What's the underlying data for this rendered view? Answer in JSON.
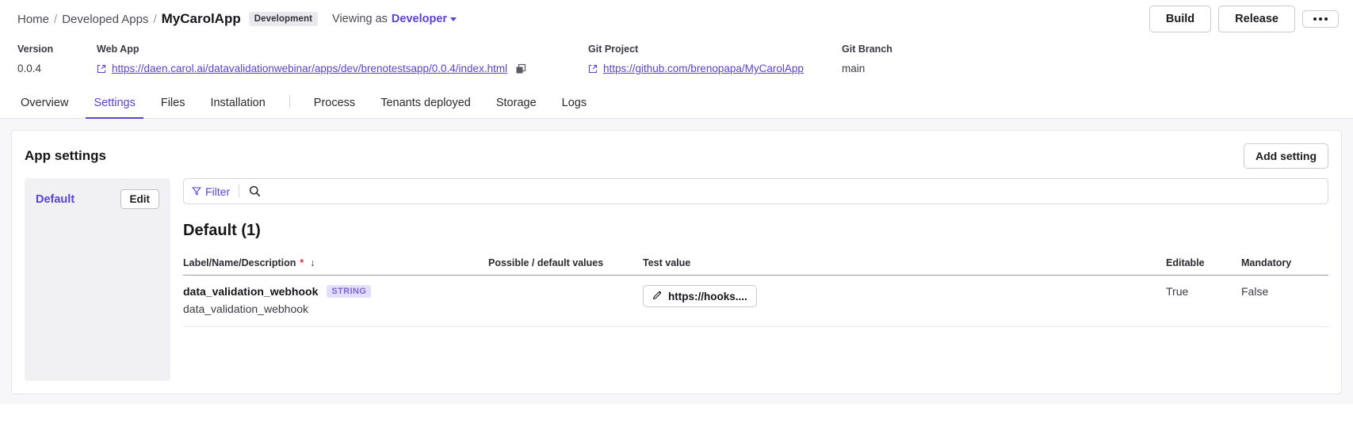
{
  "breadcrumb": {
    "home": "Home",
    "section": "Developed Apps",
    "current": "MyCarolApp",
    "env_badge": "Development",
    "viewing_as_label": "Viewing as",
    "viewer_role": "Developer"
  },
  "topbar": {
    "build_label": "Build",
    "release_label": "Release",
    "more_label": "more-options"
  },
  "meta": {
    "version_label": "Version",
    "version_value": "0.0.4",
    "webapp_label": "Web App",
    "webapp_url": "https://daen.carol.ai/datavalidationwebinar/apps/dev/brenotestsapp/0.0.4/index.html",
    "gitproject_label": "Git Project",
    "gitproject_url": "https://github.com/brenopapa/MyCarolApp",
    "gitbranch_label": "Git Branch",
    "gitbranch_value": "main"
  },
  "tabs": [
    {
      "label": "Overview",
      "active": false
    },
    {
      "label": "Settings",
      "active": true
    },
    {
      "label": "Files",
      "active": false
    },
    {
      "label": "Installation",
      "active": false
    },
    {
      "label": "Process",
      "active": false
    },
    {
      "label": "Tenants deployed",
      "active": false
    },
    {
      "label": "Storage",
      "active": false
    },
    {
      "label": "Logs",
      "active": false
    }
  ],
  "card": {
    "title": "App settings",
    "add_setting_label": "Add setting"
  },
  "groups": {
    "name": "Default",
    "edit_label": "Edit"
  },
  "toolbar": {
    "filter_label": "Filter",
    "search_placeholder": ""
  },
  "table": {
    "section_title": "Default (1)",
    "columns": {
      "label": "Label/Name/Description",
      "required_marker": "*",
      "sort_indicator": "↓",
      "possible": "Possible / default values",
      "test": "Test value",
      "editable": "Editable",
      "mandatory": "Mandatory"
    },
    "rows": [
      {
        "name": "data_validation_webhook",
        "type": "STRING",
        "description": "data_validation_webhook",
        "possible": "",
        "test_value": "https://hooks....",
        "editable": "True",
        "mandatory": "False"
      }
    ]
  },
  "colors": {
    "accent": "#5b42d6",
    "badge_bg": "#e4ddfb",
    "required": "#e03030"
  }
}
